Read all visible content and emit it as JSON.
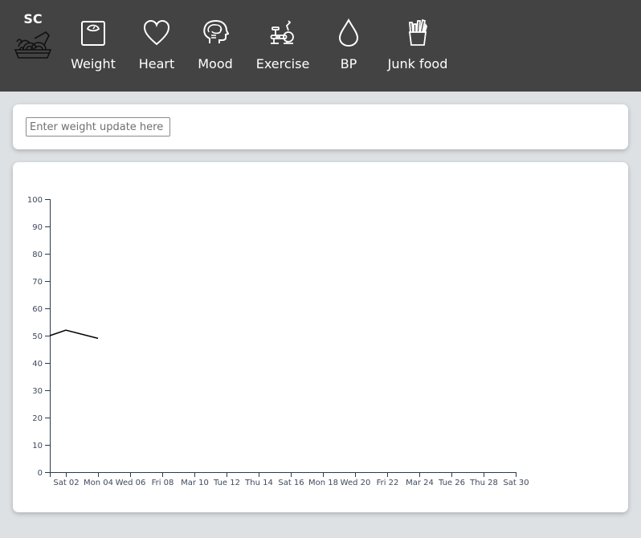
{
  "header": {
    "brand": {
      "text": "SC",
      "icon": "noodle-bowl-icon"
    },
    "nav": [
      {
        "label": "Weight",
        "icon": "weighing-scale-icon"
      },
      {
        "label": "Heart",
        "icon": "heart-icon"
      },
      {
        "label": "Mood",
        "icon": "head-brain-icon"
      },
      {
        "label": "Exercise",
        "icon": "exercise-bike-icon"
      },
      {
        "label": "BP",
        "icon": "water-drop-icon"
      },
      {
        "label": "Junk food",
        "icon": "french-fries-icon"
      }
    ]
  },
  "weight_form": {
    "value": "",
    "placeholder": "Enter weight update here"
  },
  "colors": {
    "header_bg": "#434343",
    "page_bg": "#dde1e4",
    "card_bg": "#ffffff",
    "axis": "#2b3a4e",
    "line": "#000000"
  },
  "chart_data": {
    "type": "line",
    "title": "",
    "xlabel": "",
    "ylabel": "",
    "ylim": [
      0,
      100
    ],
    "yticks": [
      0,
      10,
      20,
      30,
      40,
      50,
      60,
      70,
      80,
      90,
      100
    ],
    "xlim_days": [
      1,
      30
    ],
    "xticks": [
      {
        "day": 2,
        "label": "Sat 02"
      },
      {
        "day": 4,
        "label": "Mon 04"
      },
      {
        "day": 6,
        "label": "Wed 06"
      },
      {
        "day": 8,
        "label": "Fri 08"
      },
      {
        "day": 10,
        "label": "Mar 10"
      },
      {
        "day": 12,
        "label": "Tue 12"
      },
      {
        "day": 14,
        "label": "Thu 14"
      },
      {
        "day": 16,
        "label": "Sat 16"
      },
      {
        "day": 18,
        "label": "Mon 18"
      },
      {
        "day": 20,
        "label": "Wed 20"
      },
      {
        "day": 22,
        "label": "Fri 22"
      },
      {
        "day": 24,
        "label": "Mar 24"
      },
      {
        "day": 26,
        "label": "Tue 26"
      },
      {
        "day": 28,
        "label": "Thu 28"
      },
      {
        "day": 30,
        "label": "Sat 30"
      }
    ],
    "grid": false,
    "legend": "none",
    "series": [
      {
        "name": "Weight",
        "points": [
          {
            "day": 1,
            "value": 50
          },
          {
            "day": 2,
            "value": 52
          },
          {
            "day": 4,
            "value": 49
          }
        ]
      }
    ]
  }
}
